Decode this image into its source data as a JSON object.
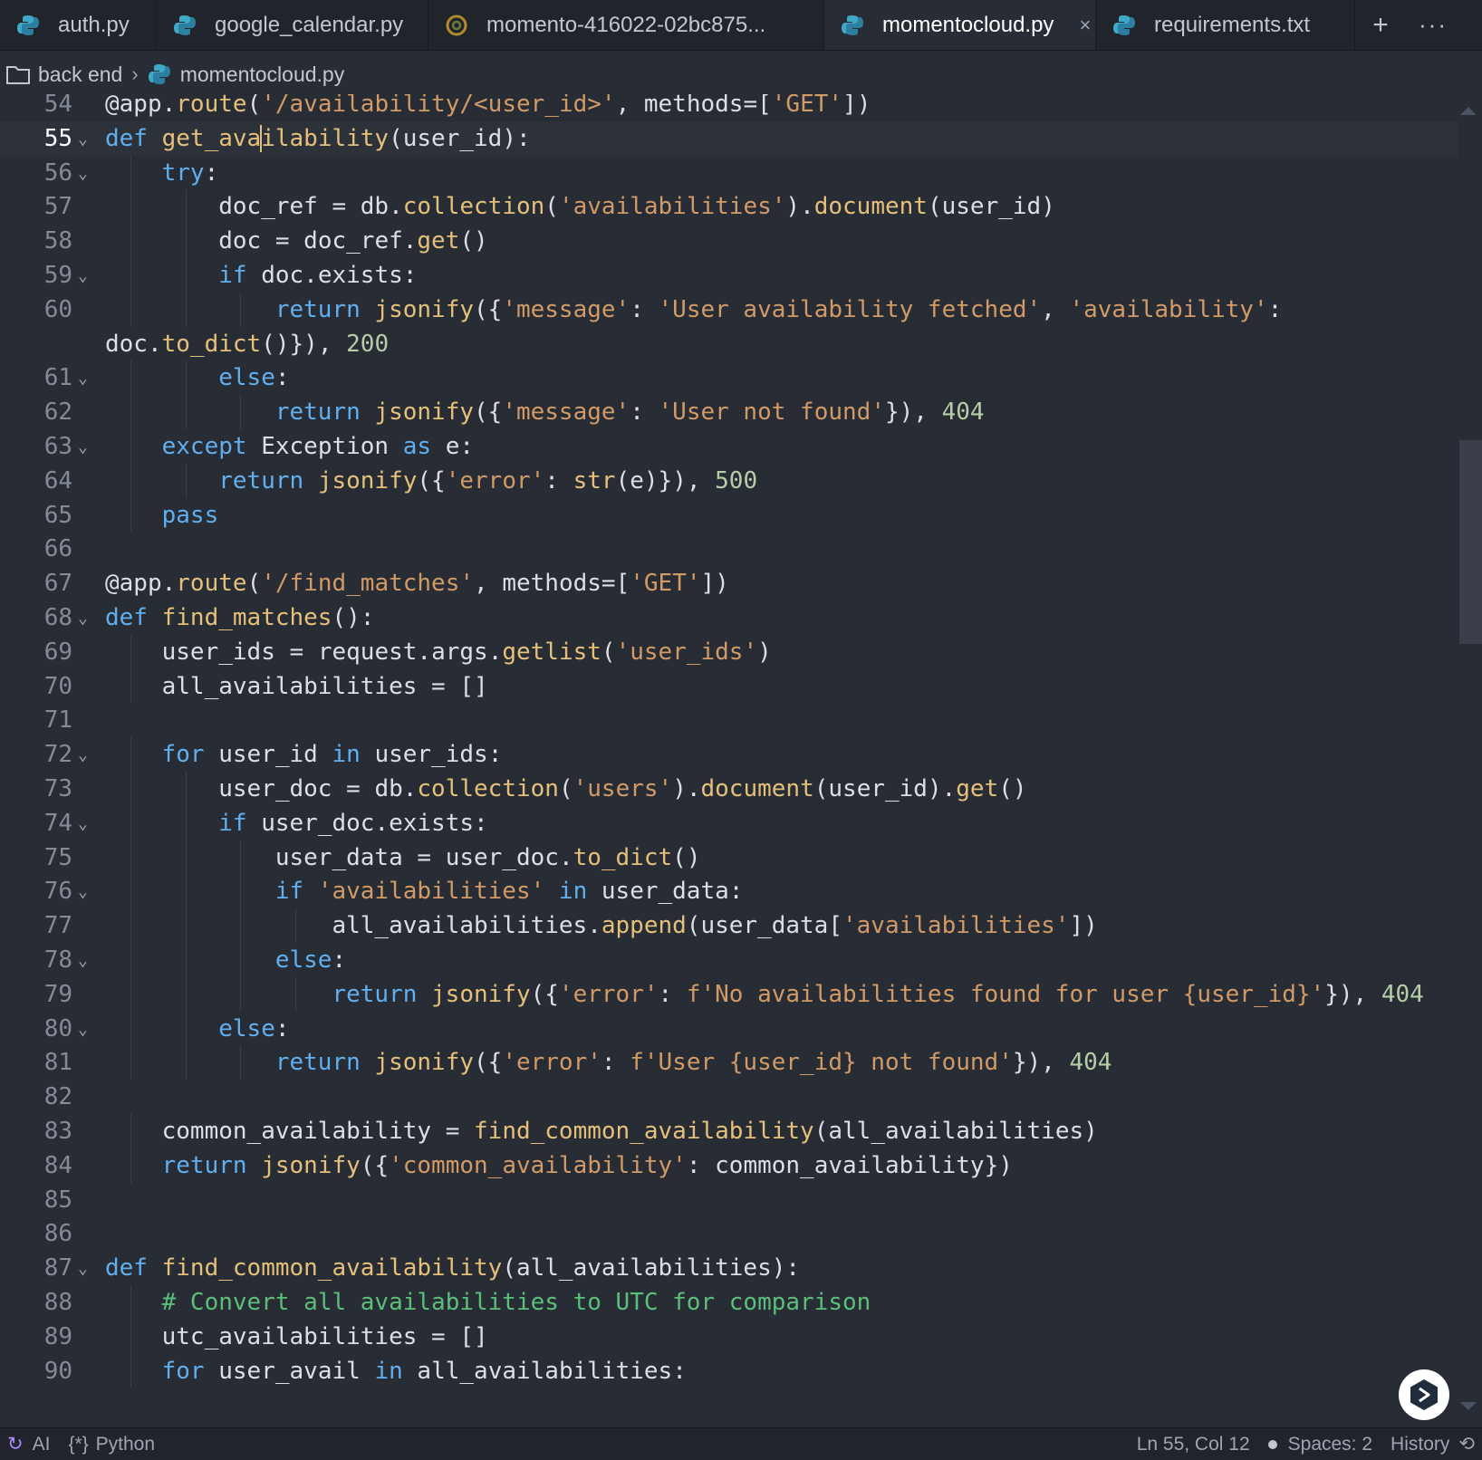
{
  "tabs": [
    {
      "label": "auth.py",
      "icon": "python-icon",
      "active": false
    },
    {
      "label": "google_calendar.py",
      "icon": "python-icon",
      "active": false
    },
    {
      "label": "momento-416022-02bc875...",
      "icon": "json-icon",
      "active": false
    },
    {
      "label": "momentocloud.py",
      "icon": "python-icon",
      "active": true,
      "close": "×"
    },
    {
      "label": "requirements.txt",
      "icon": "python-icon",
      "active": false
    }
  ],
  "tab_add": "+",
  "tab_more": "···",
  "breadcrumb": {
    "folder": "back end",
    "separator": "›",
    "file": "momentocloud.py"
  },
  "editor": {
    "current_line": 55,
    "lines": [
      {
        "n": "54",
        "fold": false,
        "text": "@app.route('/availability/<user_id>', methods=['GET'])"
      },
      {
        "n": "55",
        "fold": true,
        "text": "def get_availability(user_id):"
      },
      {
        "n": "56",
        "fold": true,
        "text": "    try:"
      },
      {
        "n": "57",
        "fold": false,
        "text": "        doc_ref = db.collection('availabilities').document(user_id)"
      },
      {
        "n": "58",
        "fold": false,
        "text": "        doc = doc_ref.get()"
      },
      {
        "n": "59",
        "fold": true,
        "text": "        if doc.exists:"
      },
      {
        "n": "60",
        "fold": false,
        "text": "            return jsonify({'message': 'User availability fetched', 'availability':"
      },
      {
        "n": "",
        "fold": false,
        "text": "doc.to_dict()}), 200"
      },
      {
        "n": "61",
        "fold": true,
        "text": "        else:"
      },
      {
        "n": "62",
        "fold": false,
        "text": "            return jsonify({'message': 'User not found'}), 404"
      },
      {
        "n": "63",
        "fold": true,
        "text": "    except Exception as e:"
      },
      {
        "n": "64",
        "fold": false,
        "text": "        return jsonify({'error': str(e)}), 500"
      },
      {
        "n": "65",
        "fold": false,
        "text": "    pass"
      },
      {
        "n": "66",
        "fold": false,
        "text": ""
      },
      {
        "n": "67",
        "fold": false,
        "text": "@app.route('/find_matches', methods=['GET'])"
      },
      {
        "n": "68",
        "fold": true,
        "text": "def find_matches():"
      },
      {
        "n": "69",
        "fold": false,
        "text": "    user_ids = request.args.getlist('user_ids')"
      },
      {
        "n": "70",
        "fold": false,
        "text": "    all_availabilities = []"
      },
      {
        "n": "71",
        "fold": false,
        "text": ""
      },
      {
        "n": "72",
        "fold": true,
        "text": "    for user_id in user_ids:"
      },
      {
        "n": "73",
        "fold": false,
        "text": "        user_doc = db.collection('users').document(user_id).get()"
      },
      {
        "n": "74",
        "fold": true,
        "text": "        if user_doc.exists:"
      },
      {
        "n": "75",
        "fold": false,
        "text": "            user_data = user_doc.to_dict()"
      },
      {
        "n": "76",
        "fold": true,
        "text": "            if 'availabilities' in user_data:"
      },
      {
        "n": "77",
        "fold": false,
        "text": "                all_availabilities.append(user_data['availabilities'])"
      },
      {
        "n": "78",
        "fold": true,
        "text": "            else:"
      },
      {
        "n": "79",
        "fold": false,
        "text": "                return jsonify({'error': f'No availabilities found for user {user_id}'}), 404"
      },
      {
        "n": "80",
        "fold": true,
        "text": "        else:"
      },
      {
        "n": "81",
        "fold": false,
        "text": "            return jsonify({'error': f'User {user_id} not found'}), 404"
      },
      {
        "n": "82",
        "fold": false,
        "text": ""
      },
      {
        "n": "83",
        "fold": false,
        "text": "    common_availability = find_common_availability(all_availabilities)"
      },
      {
        "n": "84",
        "fold": false,
        "text": "    return jsonify({'common_availability': common_availability})"
      },
      {
        "n": "85",
        "fold": false,
        "text": ""
      },
      {
        "n": "86",
        "fold": false,
        "text": ""
      },
      {
        "n": "87",
        "fold": true,
        "text": "def find_common_availability(all_availabilities):"
      },
      {
        "n": "88",
        "fold": false,
        "text": "    # Convert all availabilities to UTC for comparison"
      },
      {
        "n": "89",
        "fold": false,
        "text": "    utc_availabilities = []"
      },
      {
        "n": "90",
        "fold": false,
        "text": "    for user_avail in all_availabilities:"
      }
    ]
  },
  "status": {
    "ai": "AI",
    "language_icon": "{*}",
    "language": "Python",
    "position": "Ln 55, Col 12",
    "spaces": "Spaces: 2",
    "history": "History"
  },
  "colors": {
    "background": "#282c34",
    "keyword": "#61afef",
    "function": "#e5c07b",
    "string": "#d19a66",
    "number": "#b5cea8",
    "comment": "#5bbf7a"
  }
}
